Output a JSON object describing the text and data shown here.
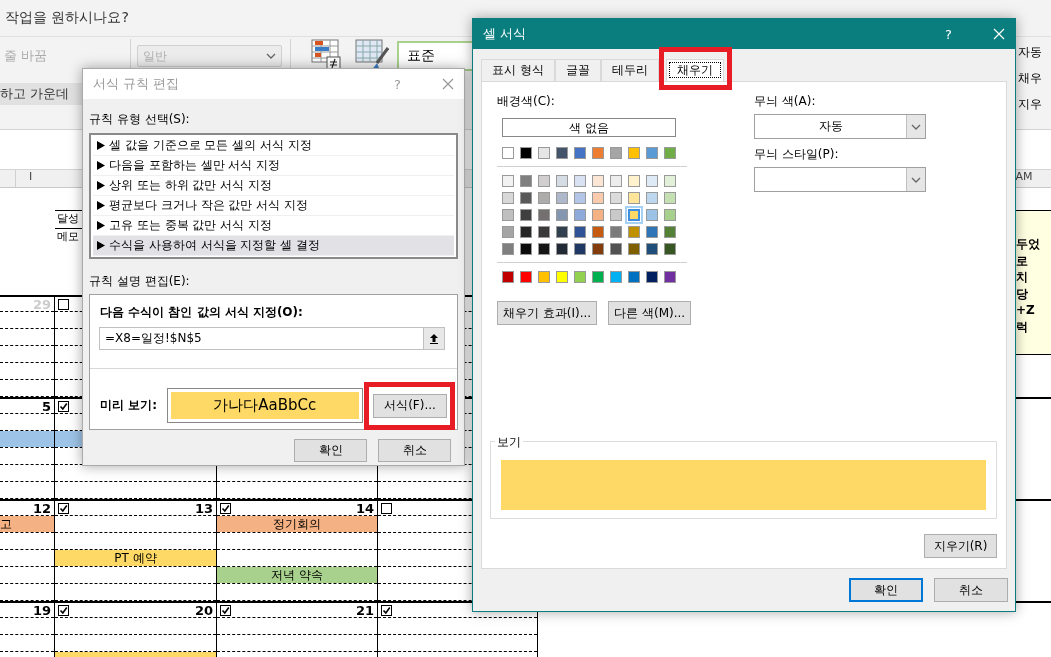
{
  "excel": {
    "tell_me": "작업을 원하시나요?",
    "ribbon": {
      "wrap_text": "줄 바꿈",
      "merge_center": "하고 가운데",
      "number_format": {
        "value": "일반",
        "disabled": true
      },
      "cell_style": "표준",
      "right_items": [
        "자동",
        "채우",
        "지우"
      ]
    },
    "column_headers": [
      "I",
      "AM"
    ],
    "header_labels": [
      "달성",
      "메모"
    ],
    "note_lines": [
      "두었",
      "로",
      "치",
      "당",
      "+Z",
      "럭"
    ],
    "weeks": [
      {
        "cells": [
          {
            "number": "29",
            "dimmed": true
          },
          {
            "checked": false
          }
        ]
      },
      {
        "cells": [
          {
            "number": "5",
            "dimmed": false,
            "lines": [
              {
                "kind": "blank"
              },
              {
                "kind": "event",
                "color": "#9dc3e6"
              }
            ]
          },
          {
            "checked": true,
            "lines": [
              {
                "kind": "blank"
              },
              {
                "kind": "event",
                "color": "#9dc3e6"
              }
            ]
          }
        ]
      },
      {
        "cells": [
          {
            "number": "12",
            "dimmed": false,
            "lines": [
              {
                "kind": "event",
                "label": "고",
                "color": "#f4b183"
              }
            ]
          },
          {
            "checked": true,
            "number": "13",
            "dimmed": false,
            "lines": [
              {
                "kind": "blank"
              },
              {
                "kind": "blank"
              },
              {
                "kind": "event",
                "label": "PT 예약",
                "color": "#ffd965"
              }
            ]
          },
          {
            "checked": true,
            "number": "14",
            "dimmed": false,
            "lines": [
              {
                "kind": "event",
                "label": "정기회의",
                "color": "#f4b183"
              },
              {
                "kind": "blank"
              },
              {
                "kind": "blank"
              },
              {
                "kind": "event",
                "label": "저녁 약속",
                "color": "#a9d18e"
              }
            ]
          },
          {
            "checked": false
          }
        ]
      },
      {
        "cells": [
          {
            "number": "19",
            "dimmed": false
          },
          {
            "checked": true,
            "number": "20",
            "dimmed": false,
            "lines": [
              {
                "kind": "blank"
              },
              {
                "kind": "blank"
              },
              {
                "kind": "event",
                "color": "#ffd965"
              }
            ]
          },
          {
            "checked": true,
            "number": "21",
            "dimmed": false
          },
          {
            "checked": true
          }
        ]
      }
    ]
  },
  "rule_dialog": {
    "title": "서식 규칙 편집",
    "active": false,
    "help": "?",
    "type_label": "규칙 유형 선택(S):",
    "rule_types": [
      {
        "label": "셀 값을 기준으로 모든 셀의 서식 지정",
        "selected": false
      },
      {
        "label": "다음을 포함하는 셀만 서식 지정",
        "selected": false
      },
      {
        "label": "상위 또는 하위 값만 서식 지정",
        "selected": false
      },
      {
        "label": "평균보다 크거나 작은 값만 서식 지정",
        "selected": false
      },
      {
        "label": "고유 또는 중복 값만 서식 지정",
        "selected": false
      },
      {
        "label": "수식을 사용하여 서식을 지정할 셀 결정",
        "selected": true
      }
    ],
    "desc_label": "규칙 설명 편집(E):",
    "formula_label": "다음 수식이 참인 값의 서식 지정(O):",
    "formula": "=X8=일정!$N$5",
    "preview_label": "미리 보기:",
    "preview_text": "가나다AaBbCc",
    "format_button": {
      "label": "서식(F)...",
      "highlighted": true
    },
    "buttons": [
      "확인",
      "취소"
    ]
  },
  "format_dialog": {
    "title": "셀 서식",
    "active": true,
    "help": "?",
    "tabs": [
      {
        "label": "표시 형식",
        "selected": false,
        "highlighted": false
      },
      {
        "label": "글꼴",
        "selected": false,
        "highlighted": false
      },
      {
        "label": "테두리",
        "selected": false,
        "highlighted": false
      },
      {
        "label": "채우기",
        "selected": true,
        "highlighted": true
      }
    ],
    "bg_label": "배경색(C):",
    "no_color": "색 없음",
    "theme_colors": [
      {
        "color": "#ffffff",
        "selected": false
      },
      {
        "color": "#000000",
        "selected": false
      },
      {
        "color": "#e7e6e6",
        "selected": false
      },
      {
        "color": "#44546a",
        "selected": false
      },
      {
        "color": "#4472c4",
        "selected": false
      },
      {
        "color": "#ed7d31",
        "selected": false
      },
      {
        "color": "#a5a5a5",
        "selected": false
      },
      {
        "color": "#ffc000",
        "selected": false
      },
      {
        "color": "#5b9bd5",
        "selected": false
      },
      {
        "color": "#70ad47",
        "selected": false
      }
    ],
    "tint_rows": [
      [
        {
          "color": "#f2f2f2",
          "selected": false
        },
        {
          "color": "#7f7f7f",
          "selected": false
        },
        {
          "color": "#d0cece",
          "selected": false
        },
        {
          "color": "#d6dce4",
          "selected": false
        },
        {
          "color": "#d9e2f3",
          "selected": false
        },
        {
          "color": "#fbe5d5",
          "selected": false
        },
        {
          "color": "#ededed",
          "selected": false
        },
        {
          "color": "#fff2cc",
          "selected": false
        },
        {
          "color": "#deebf6",
          "selected": false
        },
        {
          "color": "#e2efd9",
          "selected": false
        }
      ],
      [
        {
          "color": "#d8d8d8",
          "selected": false
        },
        {
          "color": "#595959",
          "selected": false
        },
        {
          "color": "#aeabab",
          "selected": false
        },
        {
          "color": "#adb9ca",
          "selected": false
        },
        {
          "color": "#b4c6e7",
          "selected": false
        },
        {
          "color": "#f7cbac",
          "selected": false
        },
        {
          "color": "#dbdbdb",
          "selected": false
        },
        {
          "color": "#fee599",
          "selected": false
        },
        {
          "color": "#bdd7ee",
          "selected": false
        },
        {
          "color": "#c5e0b3",
          "selected": false
        }
      ],
      [
        {
          "color": "#bfbfbf",
          "selected": false
        },
        {
          "color": "#3f3f3f",
          "selected": false
        },
        {
          "color": "#757070",
          "selected": false
        },
        {
          "color": "#8496b0",
          "selected": false
        },
        {
          "color": "#8eaadb",
          "selected": false
        },
        {
          "color": "#f4b183",
          "selected": false
        },
        {
          "color": "#c9c9c9",
          "selected": false
        },
        {
          "color": "#ffd965",
          "selected": true
        },
        {
          "color": "#9cc3e5",
          "selected": false
        },
        {
          "color": "#a8d08d",
          "selected": false
        }
      ],
      [
        {
          "color": "#a5a5a5",
          "selected": false
        },
        {
          "color": "#262626",
          "selected": false
        },
        {
          "color": "#3a3838",
          "selected": false
        },
        {
          "color": "#323f4f",
          "selected": false
        },
        {
          "color": "#2f5496",
          "selected": false
        },
        {
          "color": "#c55a11",
          "selected": false
        },
        {
          "color": "#7b7b7b",
          "selected": false
        },
        {
          "color": "#bf9000",
          "selected": false
        },
        {
          "color": "#2e75b5",
          "selected": false
        },
        {
          "color": "#538135",
          "selected": false
        }
      ],
      [
        {
          "color": "#7f7f7f",
          "selected": false
        },
        {
          "color": "#0c0c0c",
          "selected": false
        },
        {
          "color": "#171616",
          "selected": false
        },
        {
          "color": "#222a35",
          "selected": false
        },
        {
          "color": "#1f3864",
          "selected": false
        },
        {
          "color": "#833c0b",
          "selected": false
        },
        {
          "color": "#525252",
          "selected": false
        },
        {
          "color": "#7f6000",
          "selected": false
        },
        {
          "color": "#1e4e79",
          "selected": false
        },
        {
          "color": "#375623",
          "selected": false
        }
      ]
    ],
    "standard_colors": [
      {
        "color": "#c00000",
        "selected": false
      },
      {
        "color": "#ff0000",
        "selected": false
      },
      {
        "color": "#ffc000",
        "selected": false
      },
      {
        "color": "#ffff00",
        "selected": false
      },
      {
        "color": "#92d050",
        "selected": false
      },
      {
        "color": "#00b050",
        "selected": false
      },
      {
        "color": "#00b0f0",
        "selected": false
      },
      {
        "color": "#0070c0",
        "selected": false
      },
      {
        "color": "#002060",
        "selected": false
      },
      {
        "color": "#7030a0",
        "selected": false
      }
    ],
    "effects_button": "채우기 효과(I)...",
    "more_colors_button": "다른 색(M)...",
    "pattern_color_label": "무늬 색(A):",
    "pattern_color": "자동",
    "pattern_style_label": "무늬 스타일(P):",
    "sample_label": "보기",
    "clear_button": "지우기(R)",
    "buttons": [
      {
        "label": "확인",
        "default": true
      },
      {
        "label": "취소",
        "default": false
      }
    ]
  }
}
